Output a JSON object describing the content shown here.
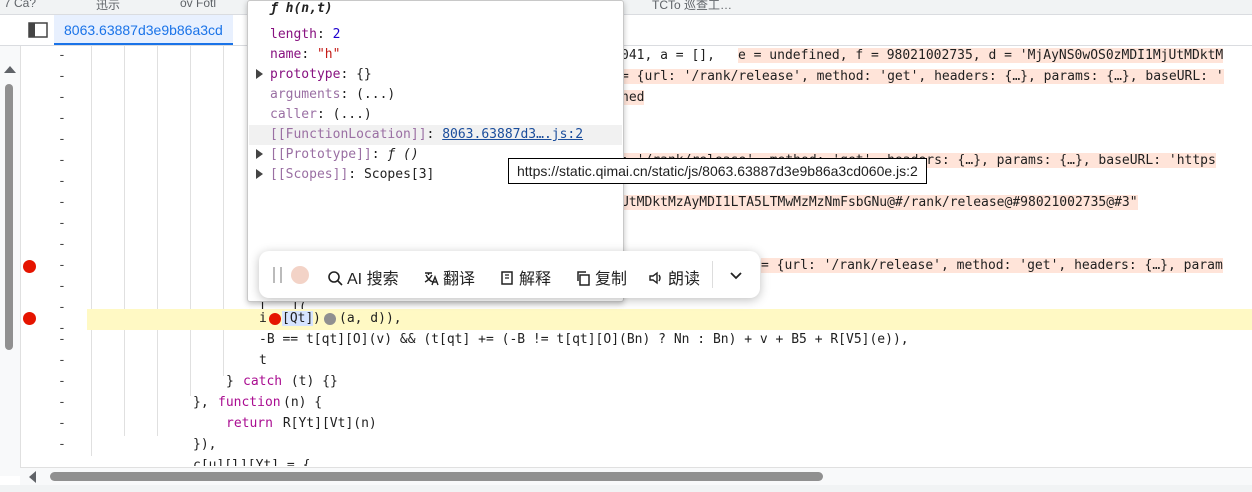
{
  "tab": {
    "file_name": "8063.63887d3e9b86a3cd"
  },
  "popup": {
    "title": "ƒ h(n,t)",
    "props": {
      "length_key": "length",
      "length_val": "2",
      "name_key": "name",
      "name_val": "\"h\"",
      "prototype_key": "prototype",
      "prototype_val": "{}",
      "arguments_key": "arguments",
      "arguments_val": "(...)",
      "caller_key": "caller",
      "caller_val": "(...)",
      "fnloc_key": "[[FunctionLocation]]",
      "fnloc_val": "8063.63887d3….js:2",
      "proto_key": "[[Prototype]]",
      "proto_val": "ƒ ()",
      "scopes_key": "[[Scopes]]",
      "scopes_val": "Scopes[3]"
    }
  },
  "tooltip": {
    "url": "https://static.qimai.cn/static/js/8063.63887d3e9b86a3cd060e.js:2"
  },
  "ai_toolbar": {
    "search": "AI 搜索",
    "translate": "翻译",
    "explain": "解释",
    "copy": "复制",
    "read": "朗读"
  },
  "code": {
    "l0_code": "041, a = [], ",
    "l0_val": "e = undefined, f = 98021002735, d = 'MjAyNS0wOS0zMDI1MjUtMDktM",
    "l1_val": "= {url: '/rank/release', method: 'get', headers: {…}, params: {…}, baseURL: '",
    "l2_val": "ned",
    "l5_val": ": '/rank/release', method: 'get', headers: {…}, params: {…}, baseURL: 'https",
    "l7_val": "UtMDktMzAyMDI1LTA5LTMwMzMzNmFsbGNu@#/rank/release@#98021002735@#3\"",
    "l10_val": "= {url: '/rank/release', method: 'get', headers: {…}, param",
    "l12_pre": "[",
    "l12_mid": "](",
    "l13_i": "i",
    "l13_qt": "[Qt]",
    "l13_rest": "(a, d)),",
    "l14": "-B == t[qt][O](v) && (t[qt] += (-B != t[qt][O](Bn) ? Nn : Bn) + v + B5 + R[V5](e)),",
    "l15": "t",
    "l16_a": "} ",
    "l16_catch": "catch",
    "l16_b": " (t) {}",
    "l17_a": "}, ",
    "l17_fn": "function",
    "l17_b": "(n) {",
    "l18_ret": "return",
    "l18_b": " R[Yt][Vt](n)",
    "l19": "}),",
    "l20": "c[u][l][Yt] = {"
  },
  "gutter": {
    "dash": "-"
  },
  "top_strip": {
    "frag1": "7 Ca?",
    "frag2": "迅示",
    "frag3": "ov Fotl",
    "frag4": "TCTo 巡查工…"
  }
}
